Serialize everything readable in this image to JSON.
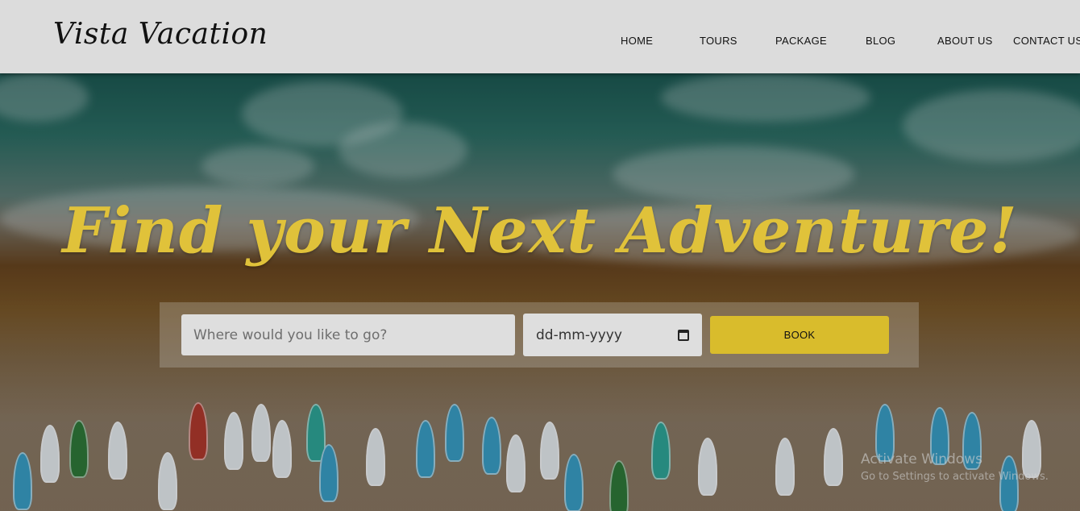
{
  "brand": {
    "logo": "Vista Vacation"
  },
  "nav": {
    "items": [
      "HOME",
      "TOURS",
      "PACKAGE",
      "BLOG",
      "ABOUT US",
      "CONTACT US"
    ]
  },
  "hero": {
    "headline": "Find your Next Adventure!"
  },
  "search": {
    "destination_placeholder": "Where would you like to go?",
    "date_placeholder": "dd-mm-yyyy",
    "book_label": "BOOK"
  },
  "watermark": {
    "line1": "Activate Windows",
    "line2": "Go to Settings to activate Windows."
  },
  "colors": {
    "header_bg": "#dcdcdc",
    "accent": "#d9bc2c",
    "headline": "#e0c23a"
  },
  "icons": {
    "date_picker": "calendar-icon"
  }
}
